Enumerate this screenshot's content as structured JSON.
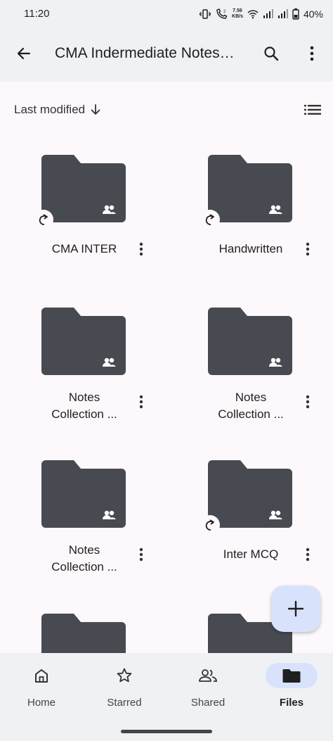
{
  "status_bar": {
    "time": "11:20",
    "net_speed_value": "7.56",
    "net_speed_unit": "KB/s",
    "battery_percent": "40%",
    "icons": [
      "vibrate-icon",
      "call-icon",
      "wifi-icon",
      "signal-icon",
      "signal-icon",
      "battery-icon"
    ]
  },
  "app_bar": {
    "title": "CMA Indermediate Notes…",
    "back_icon": "arrow-back-icon",
    "search_icon": "search-icon",
    "more_icon": "more-vert-icon"
  },
  "sort": {
    "label": "Last modified",
    "direction_icon": "arrow-down-icon",
    "view_icon": "list-view-icon"
  },
  "folders": [
    {
      "name": "CMA INTER",
      "shared": true,
      "shortcut": true
    },
    {
      "name": "Handwritten",
      "shared": true,
      "shortcut": true
    },
    {
      "name_line1": "Notes",
      "name_line2": "Collection ...",
      "shared": true,
      "shortcut": false
    },
    {
      "name_line1": "Notes",
      "name_line2": "Collection ...",
      "shared": true,
      "shortcut": false
    },
    {
      "name_line1": "Notes",
      "name_line2": "Collection ...",
      "shared": true,
      "shortcut": false
    },
    {
      "name": "Inter MCQ",
      "shared": true,
      "shortcut": true
    }
  ],
  "fab": {
    "icon": "plus-icon"
  },
  "bottom_nav": {
    "items": [
      {
        "label": "Home",
        "icon": "home-icon",
        "active": false
      },
      {
        "label": "Starred",
        "icon": "star-icon",
        "active": false
      },
      {
        "label": "Shared",
        "icon": "people-icon",
        "active": false
      },
      {
        "label": "Files",
        "icon": "folder-icon",
        "active": true
      }
    ]
  },
  "colors": {
    "background": "#fdf8fb",
    "bar": "#f0f1f5",
    "folder": "#474a51",
    "accent_container": "#d8e3fb"
  }
}
